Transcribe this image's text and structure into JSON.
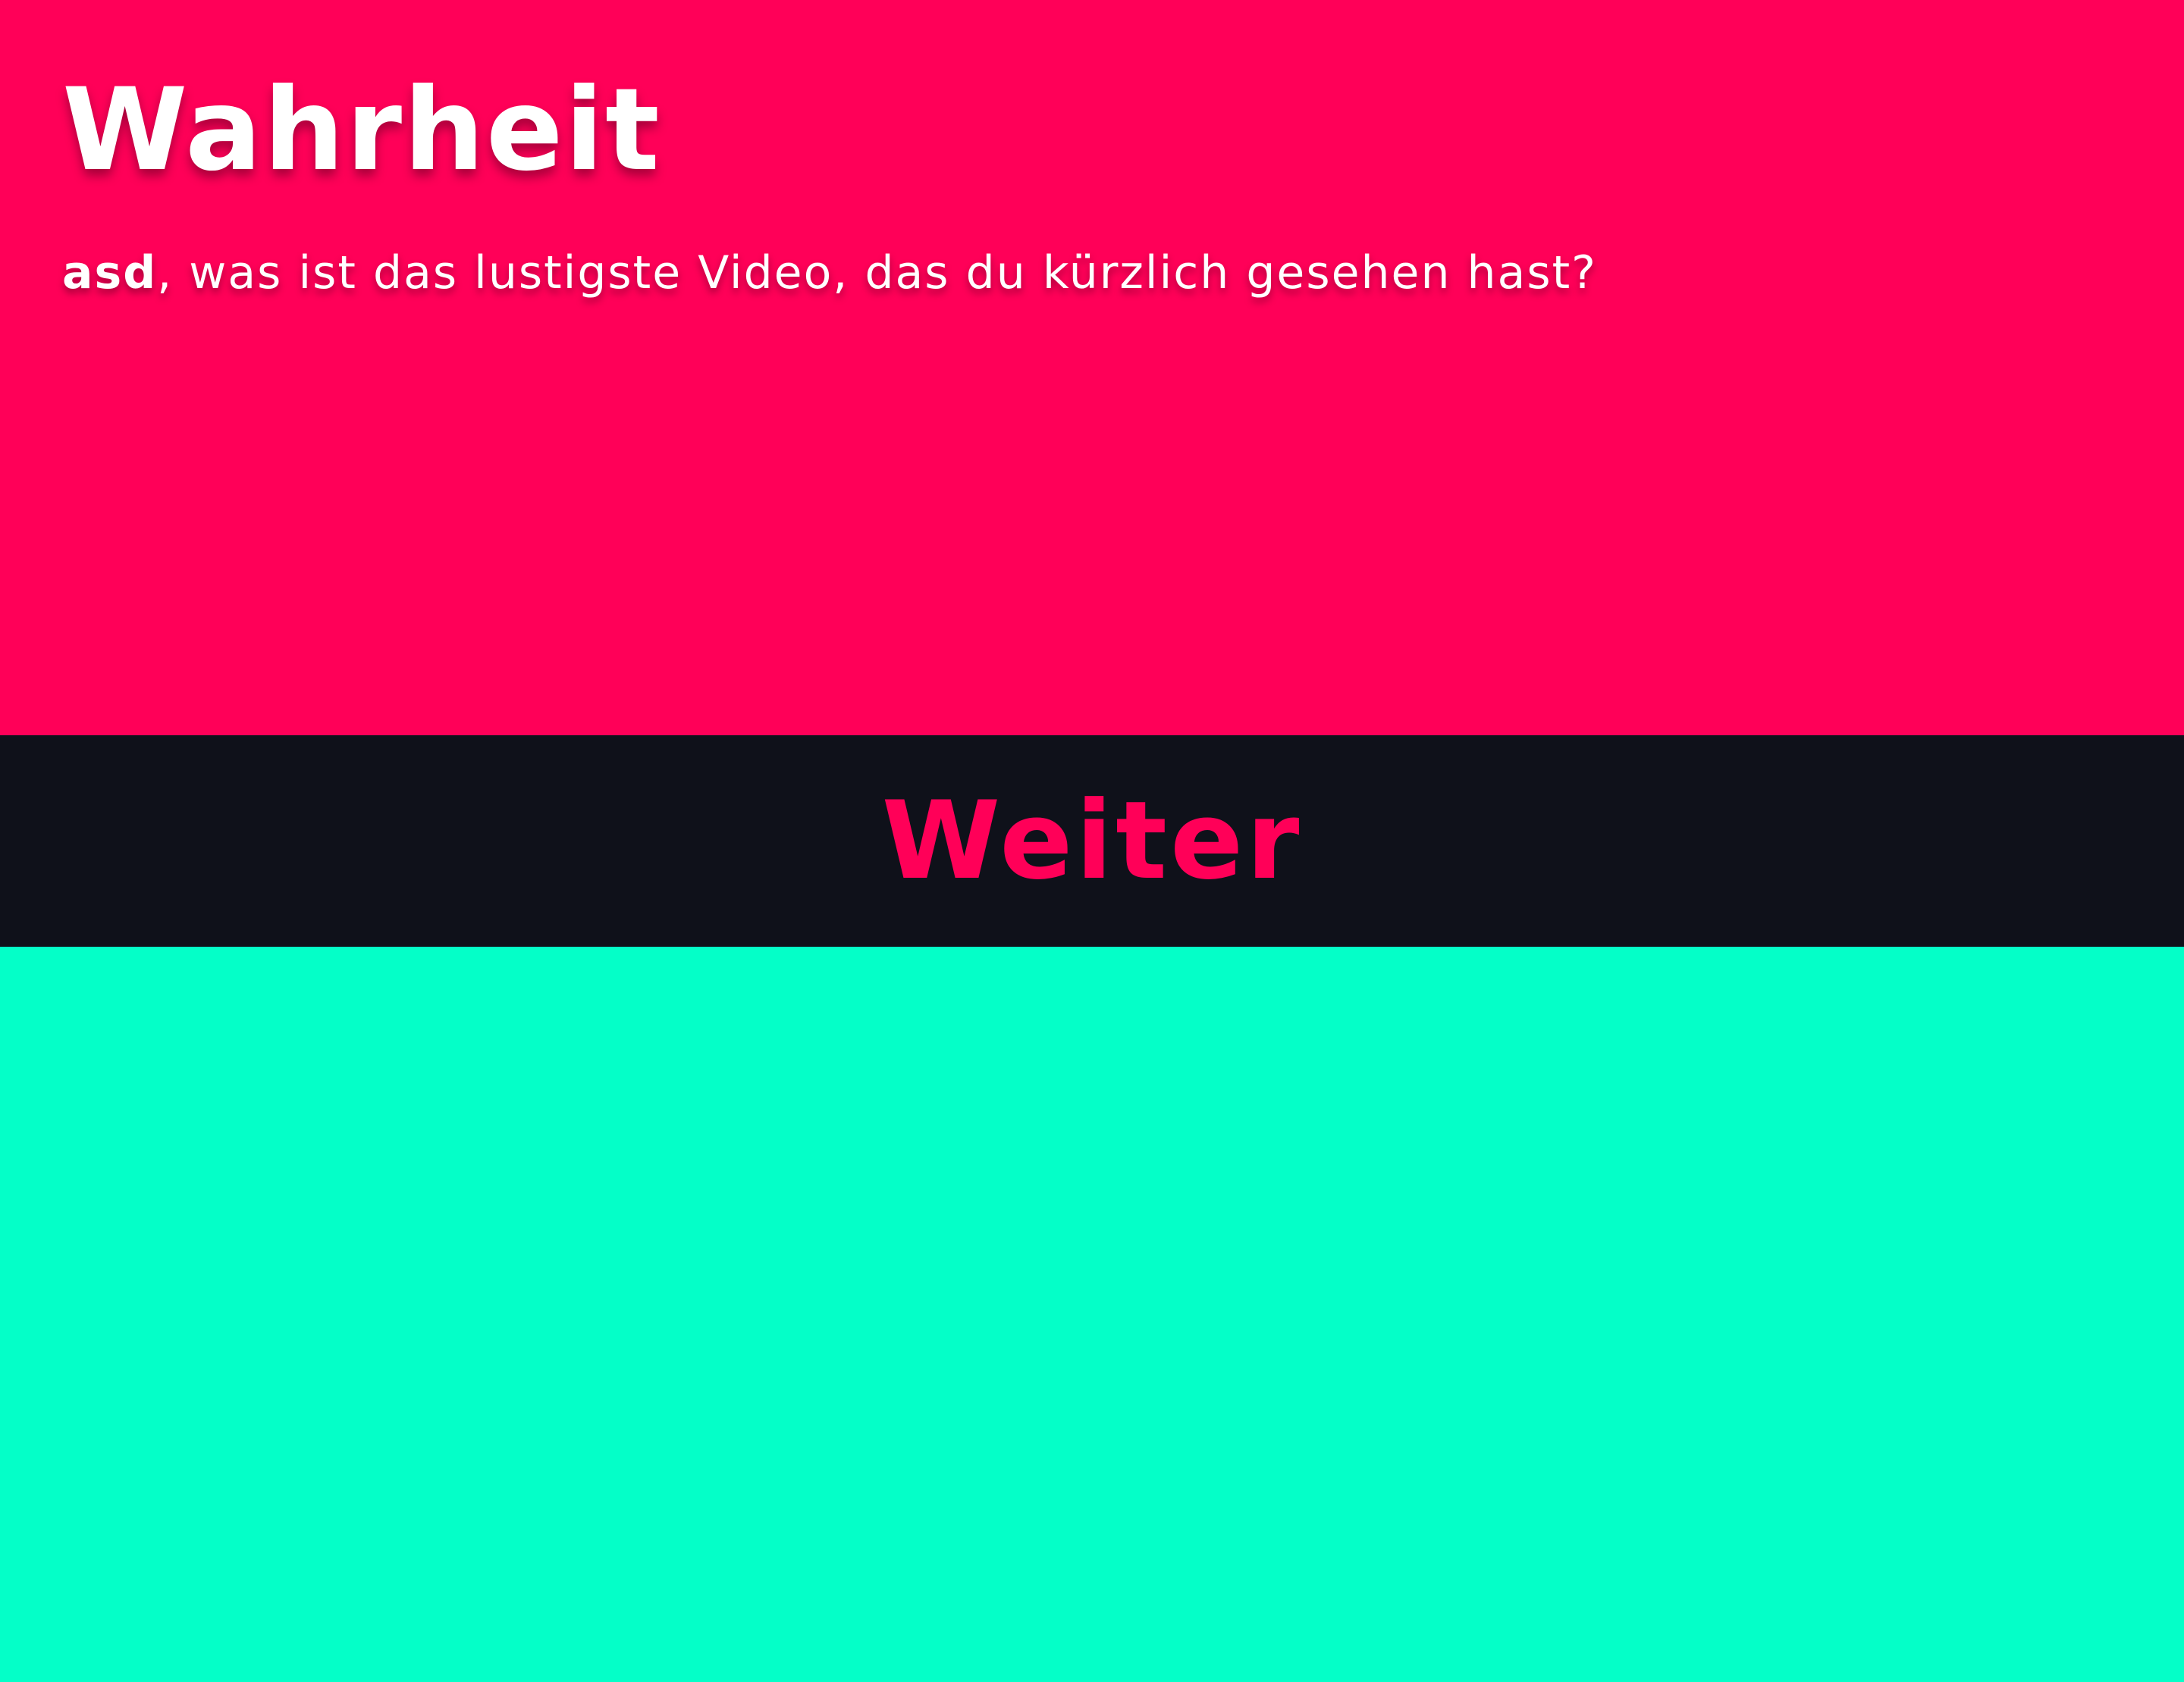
{
  "card": {
    "title": "Wahrheit",
    "player_name": "asd",
    "question_rest": ", was ist das lustigste Video, das du kürzlich gesehen hast?"
  },
  "actions": {
    "next_label": "Weiter"
  },
  "colors": {
    "card_background": "#ff0058",
    "button_background": "#0f111a",
    "button_text": "#ff0058",
    "bottom_background": "#04ffc8",
    "text": "#ffffff"
  }
}
